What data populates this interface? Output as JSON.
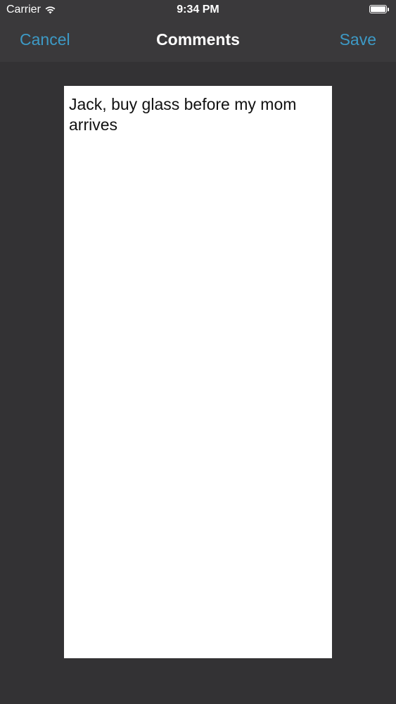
{
  "status_bar": {
    "carrier": "Carrier",
    "time": "9:34 PM",
    "wifi_icon": "wifi-icon",
    "battery_icon": "battery-icon"
  },
  "nav_bar": {
    "cancel_label": "Cancel",
    "title": "Comments",
    "save_label": "Save"
  },
  "comment": {
    "text": "Jack, buy glass before my mom arrives"
  },
  "colors": {
    "background": "#333234",
    "bar_background": "#3a393b",
    "accent": "#3d9ac6",
    "text_area": "#ffffff"
  }
}
